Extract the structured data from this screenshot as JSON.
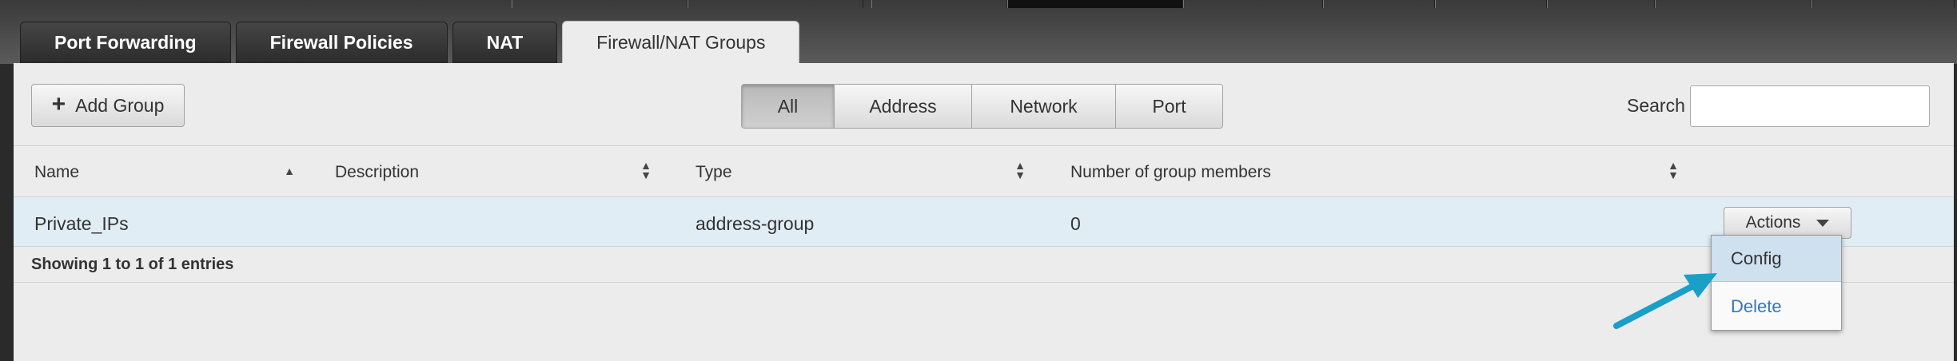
{
  "tabs": [
    {
      "label": "Port Forwarding",
      "active": false
    },
    {
      "label": "Firewall Policies",
      "active": false
    },
    {
      "label": "NAT",
      "active": false
    },
    {
      "label": "Firewall/NAT Groups",
      "active": true
    }
  ],
  "toolbar": {
    "add_group_label": "Add Group",
    "filters": [
      {
        "label": "All",
        "active": true
      },
      {
        "label": "Address",
        "active": false
      },
      {
        "label": "Network",
        "active": false
      },
      {
        "label": "Port",
        "active": false
      }
    ],
    "search_label": "Search",
    "search_value": ""
  },
  "table": {
    "columns": [
      "Name",
      "Description",
      "Type",
      "Number of group members"
    ],
    "rows": [
      {
        "name": "Private_IPs",
        "description": "",
        "type": "address-group",
        "members": "0",
        "actions_label": "Actions"
      }
    ],
    "footer": "Showing 1 to 1 of 1 entries"
  },
  "dropdown": {
    "items": [
      "Config",
      "Delete"
    ]
  },
  "colors": {
    "arrow": "#1a9fc9",
    "row_highlight": "#e0edf5",
    "link": "#3577b5"
  }
}
